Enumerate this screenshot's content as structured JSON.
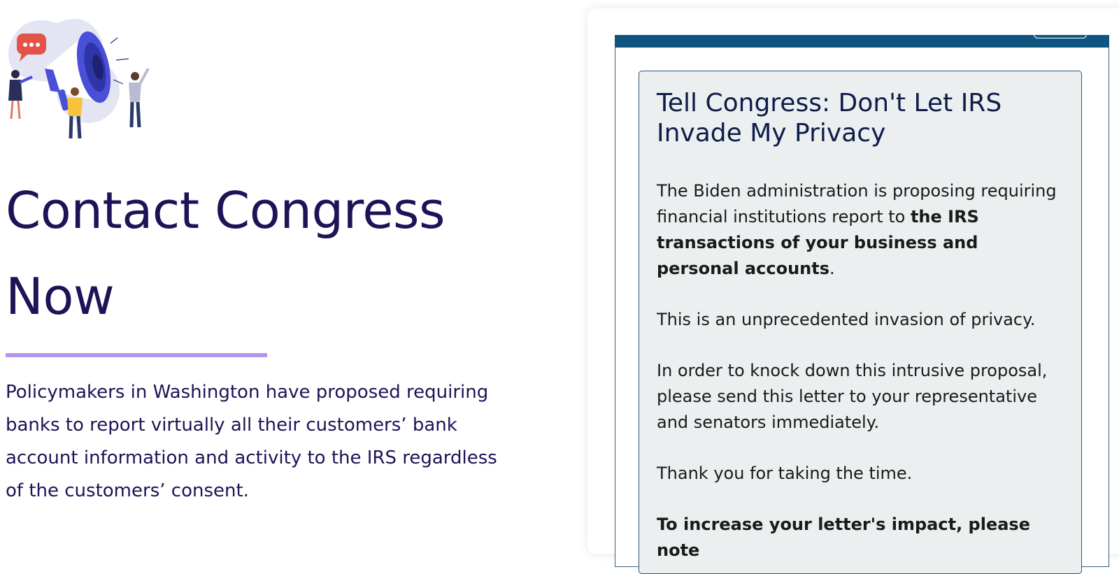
{
  "hero": {
    "title_line1": "Contact Congress",
    "title_line2": "Now",
    "intro": "Policymakers in Washington have proposed requiring banks to report virtually all their customers’ bank account information and activity to the IRS regardless of the customers’ consent.",
    "illustration_icon": "megaphone-people-illustration"
  },
  "letter": {
    "title": "Tell Congress: Don't Let IRS Invade My Privacy",
    "para1_lead": "The Biden administration is proposing requiring financial institutions report to ",
    "para1_bold": "the IRS transactions of your business and personal accounts",
    "para1_end": ".",
    "para2": "This is an unprecedented invasion of privacy.",
    "para3": "In order to knock down this intrusive proposal, please send this letter to your representative and senators immediately.",
    "para4": "Thank you for taking the time.",
    "para5_lead": "To increase your ",
    "para5_bold": "letter's impact",
    "para5_end": ", please note"
  },
  "colors": {
    "heading": "#1c1456",
    "accent_line": "#b494ee",
    "frame_bar": "#0e5680",
    "letter_bg": "#ebeff0",
    "letter_title": "#0f1c48"
  }
}
